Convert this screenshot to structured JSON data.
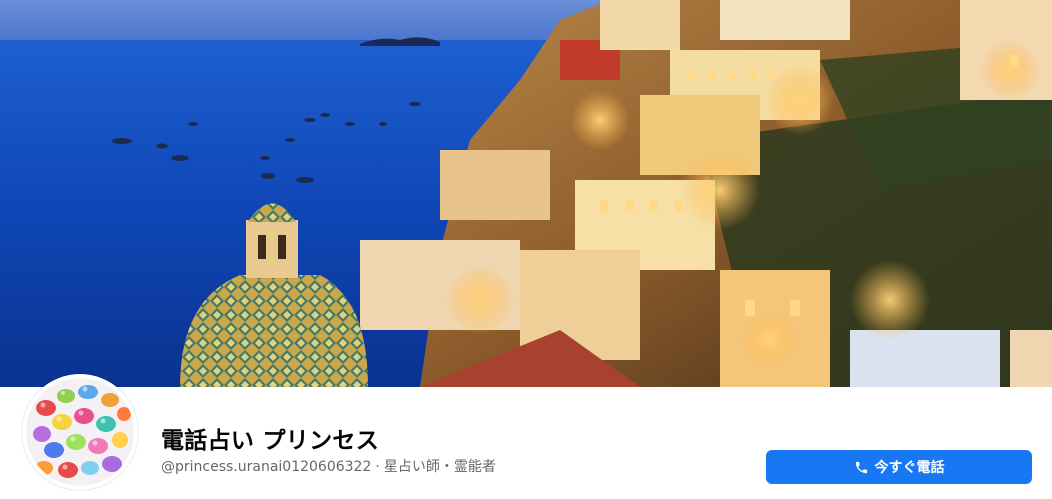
{
  "cover": {
    "alt": "Cliffside town by the sea at dusk"
  },
  "profile": {
    "name": "電話占い プリンセス",
    "handle": "@princess.uranai0120606322",
    "separator": "·",
    "category": "星占い師・霊能者"
  },
  "actions": {
    "call_label": "今すぐ電話",
    "call_icon": "phone-icon"
  },
  "colors": {
    "primary_button": "#1877f2",
    "name_text": "#050505",
    "meta_text": "#65676b"
  }
}
